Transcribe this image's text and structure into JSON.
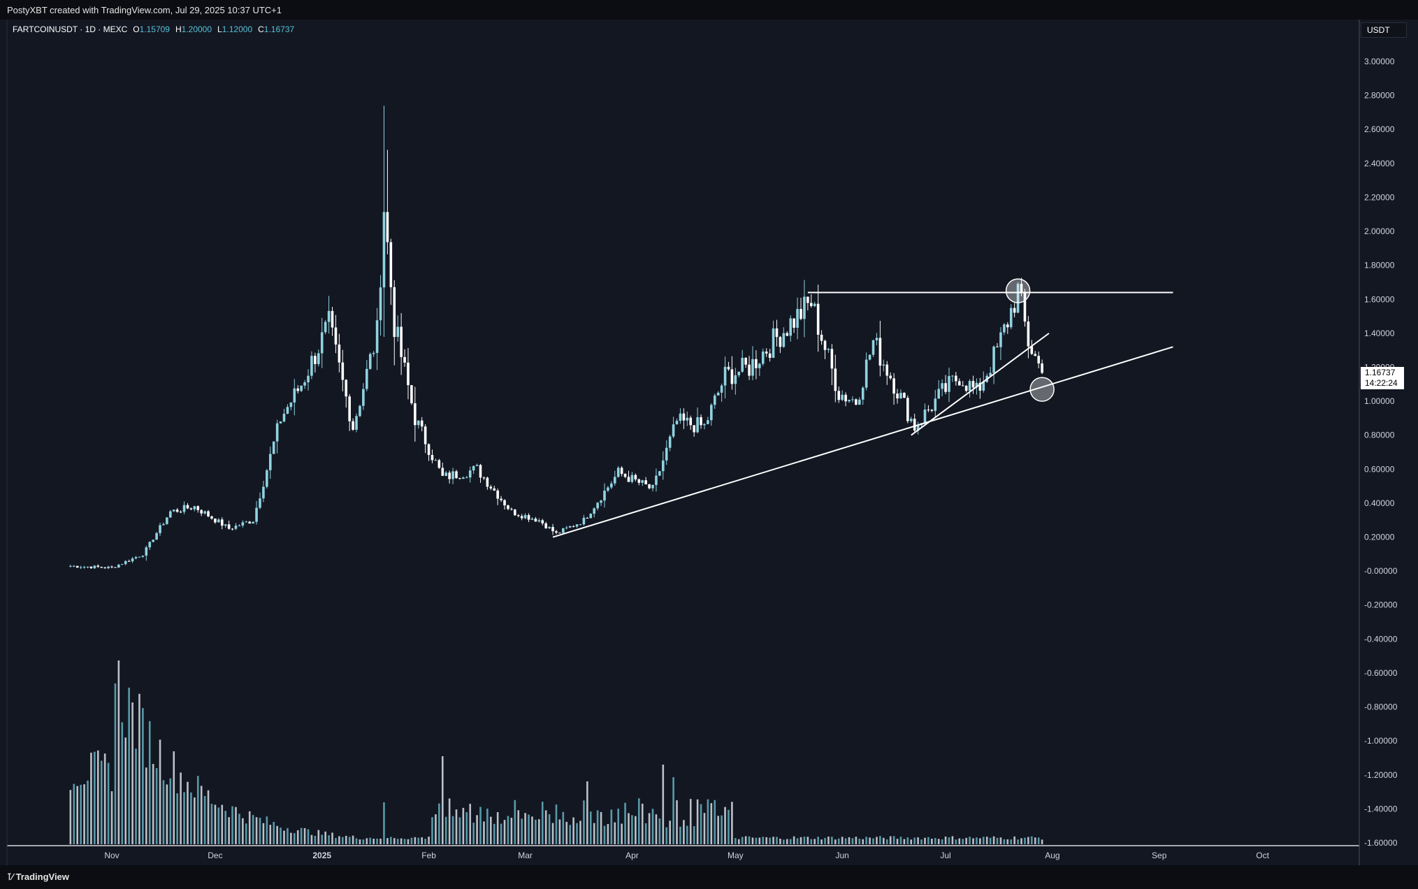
{
  "header": {
    "credit": "PostyXBT created with TradingView.com, Jul 29, 2025 10:37 UTC+1"
  },
  "legend": {
    "symbol": "FARTCOINUSDT · 1D · MEXC",
    "open_label": "O",
    "open": "1.15709",
    "high_label": "H",
    "high": "1.20000",
    "low_label": "L",
    "low": "1.12000",
    "close_label": "C",
    "close": "1.16737"
  },
  "currency": "USDT",
  "last_price": {
    "price": "1.16737",
    "countdown": "14:22:24"
  },
  "footer": {
    "brand": "TradingView"
  },
  "colors": {
    "background": "#131722",
    "candles": "#ffffff",
    "volume_up": "#5fa8b8",
    "volume_down": "#cfd3da",
    "accent": "#56c2d6"
  },
  "chart_data": {
    "type": "candlestick",
    "y_axis": {
      "ticks": [
        "3.00000",
        "2.80000",
        "2.60000",
        "2.40000",
        "2.20000",
        "2.00000",
        "1.80000",
        "1.60000",
        "1.40000",
        "1.20000",
        "1.00000",
        "0.80000",
        "0.60000",
        "0.40000",
        "0.20000",
        "-0.00000",
        "-0.20000",
        "-0.40000",
        "-0.60000",
        "-0.80000",
        "-1.00000",
        "-1.20000",
        "-1.40000",
        "-1.60000"
      ],
      "ylim": [
        -1.6,
        3.0
      ]
    },
    "x_axis": {
      "labels": [
        "Nov",
        "Dec",
        "2025",
        "Feb",
        "Mar",
        "Apr",
        "May",
        "Jun",
        "Jul",
        "Aug",
        "Sep",
        "Oct"
      ]
    },
    "price_path": [
      [
        "2024-10-20",
        0.03
      ],
      [
        "2024-11-01",
        0.02
      ],
      [
        "2024-11-10",
        0.1
      ],
      [
        "2024-11-18",
        0.35
      ],
      [
        "2024-11-25",
        0.38
      ],
      [
        "2024-12-05",
        0.25
      ],
      [
        "2024-12-12",
        0.3
      ],
      [
        "2024-12-20",
        0.9
      ],
      [
        "2024-12-26",
        1.1
      ],
      [
        "2025-01-03",
        1.45
      ],
      [
        "2025-01-10",
        0.85
      ],
      [
        "2025-01-17",
        1.4
      ],
      [
        "2025-01-19",
        2.15
      ],
      [
        "2025-01-22",
        1.45
      ],
      [
        "2025-01-28",
        0.9
      ],
      [
        "2025-02-05",
        0.55
      ],
      [
        "2025-02-15",
        0.6
      ],
      [
        "2025-02-25",
        0.35
      ],
      [
        "2025-03-05",
        0.3
      ],
      [
        "2025-03-10",
        0.22
      ],
      [
        "2025-03-18",
        0.3
      ],
      [
        "2025-03-28",
        0.58
      ],
      [
        "2025-04-07",
        0.48
      ],
      [
        "2025-04-14",
        0.88
      ],
      [
        "2025-04-22",
        0.85
      ],
      [
        "2025-04-28",
        1.15
      ],
      [
        "2025-05-05",
        1.2
      ],
      [
        "2025-05-15",
        1.42
      ],
      [
        "2025-05-23",
        1.58
      ],
      [
        "2025-05-31",
        1.05
      ],
      [
        "2025-06-05",
        1.0
      ],
      [
        "2025-06-10",
        1.35
      ],
      [
        "2025-06-15",
        1.15
      ],
      [
        "2025-06-22",
        0.85
      ],
      [
        "2025-06-30",
        1.05
      ],
      [
        "2025-07-05",
        1.15
      ],
      [
        "2025-07-10",
        1.05
      ],
      [
        "2025-07-16",
        1.3
      ],
      [
        "2025-07-22",
        1.65
      ],
      [
        "2025-07-25",
        1.35
      ],
      [
        "2025-07-29",
        1.167
      ]
    ],
    "volume_peak_date": "2024-11-02",
    "trendlines": [
      {
        "name": "horizontal-resistance",
        "from": [
          "2025-05-22",
          1.64
        ],
        "to": [
          "2025-09-05",
          1.64
        ]
      },
      {
        "name": "long-rising-support",
        "from": [
          "2025-03-09",
          0.2
        ],
        "to": [
          "2025-09-05",
          1.32
        ]
      },
      {
        "name": "steep-rising-support",
        "from": [
          "2025-06-21",
          0.8
        ],
        "to": [
          "2025-07-31",
          1.4
        ]
      }
    ],
    "markers": [
      {
        "name": "resistance-touch",
        "date": "2025-07-22",
        "price": 1.65
      },
      {
        "name": "support-test",
        "date": "2025-07-29",
        "price": 1.07
      }
    ],
    "grid": false
  }
}
